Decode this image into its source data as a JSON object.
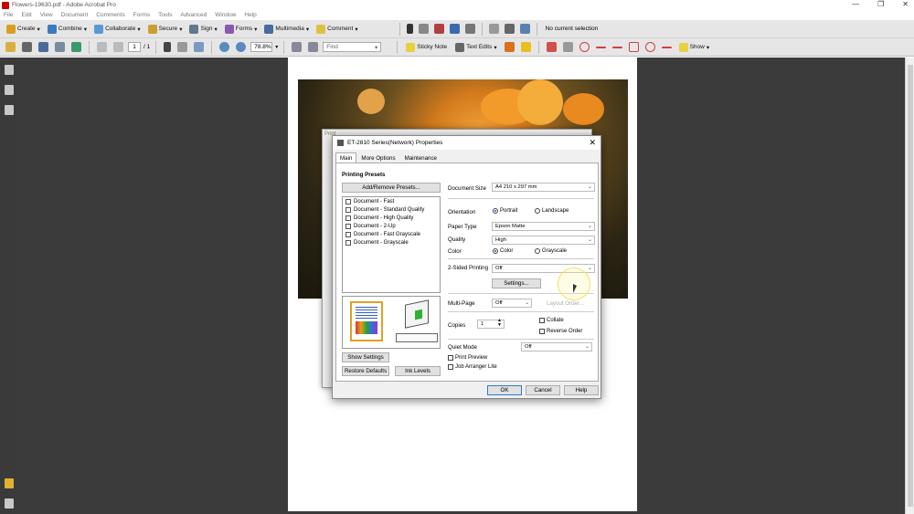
{
  "window": {
    "title": "Flowers-19630.pdf - Adobe Acrobat Pro",
    "min": "—",
    "max": "❐",
    "close": "✕"
  },
  "menu": [
    "File",
    "Edit",
    "View",
    "Document",
    "Comments",
    "Forms",
    "Tools",
    "Advanced",
    "Window",
    "Help"
  ],
  "toolbar1": {
    "create": "Create",
    "combine": "Combine",
    "collaborate": "Collaborate",
    "secure": "Secure",
    "sign": "Sign",
    "forms": "Forms",
    "multimedia": "Multimedia",
    "comment": "Comment",
    "selection_status": "No current selection"
  },
  "toolbar2": {
    "page_current": "1",
    "page_total": "/ 1",
    "zoom": "78.8%",
    "find_placeholder": "Find",
    "sticky_note": "Sticky Note",
    "text_edits": "Text Edits",
    "show": "Show"
  },
  "print_dialog": {
    "title_stub": "Print"
  },
  "dialog": {
    "title": "ET-2810 Series(Network) Properties",
    "close": "✕",
    "tabs": [
      "Main",
      "More Options",
      "Maintenance"
    ],
    "printing_presets_label": "Printing Presets",
    "add_remove_presets": "Add/Remove Presets...",
    "presets": [
      "Document - Fast",
      "Document - Standard Quality",
      "Document - High Quality",
      "Document - 2-Up",
      "Document - Fast Grayscale",
      "Document - Grayscale"
    ],
    "show_settings": "Show Settings",
    "restore_defaults": "Restore Defaults",
    "ink_levels": "Ink Levels",
    "document_size_label": "Document Size",
    "document_size_value": "A4 210 x 297 mm",
    "orientation_label": "Orientation",
    "portrait": "Portrait",
    "landscape": "Landscape",
    "paper_type_label": "Paper Type",
    "paper_type_value": "Epson Matte",
    "quality_label": "Quality",
    "quality_value": "High",
    "color_label": "Color",
    "color_option": "Color",
    "grayscale_option": "Grayscale",
    "two_sided_label": "2-Sided Printing",
    "two_sided_value": "Off",
    "settings_button": "Settings...",
    "multi_page_label": "Multi-Page",
    "multi_page_value": "Off",
    "layout_order": "Layout Order...",
    "copies_label": "Copies",
    "copies_value": "1",
    "collate": "Collate",
    "reverse_order": "Reverse Order",
    "quiet_mode_label": "Quiet Mode",
    "quiet_mode_value": "Off",
    "print_preview": "Print Preview",
    "job_arranger_lite": "Job Arranger Lite",
    "ok": "OK",
    "cancel": "Cancel",
    "help": "Help"
  }
}
